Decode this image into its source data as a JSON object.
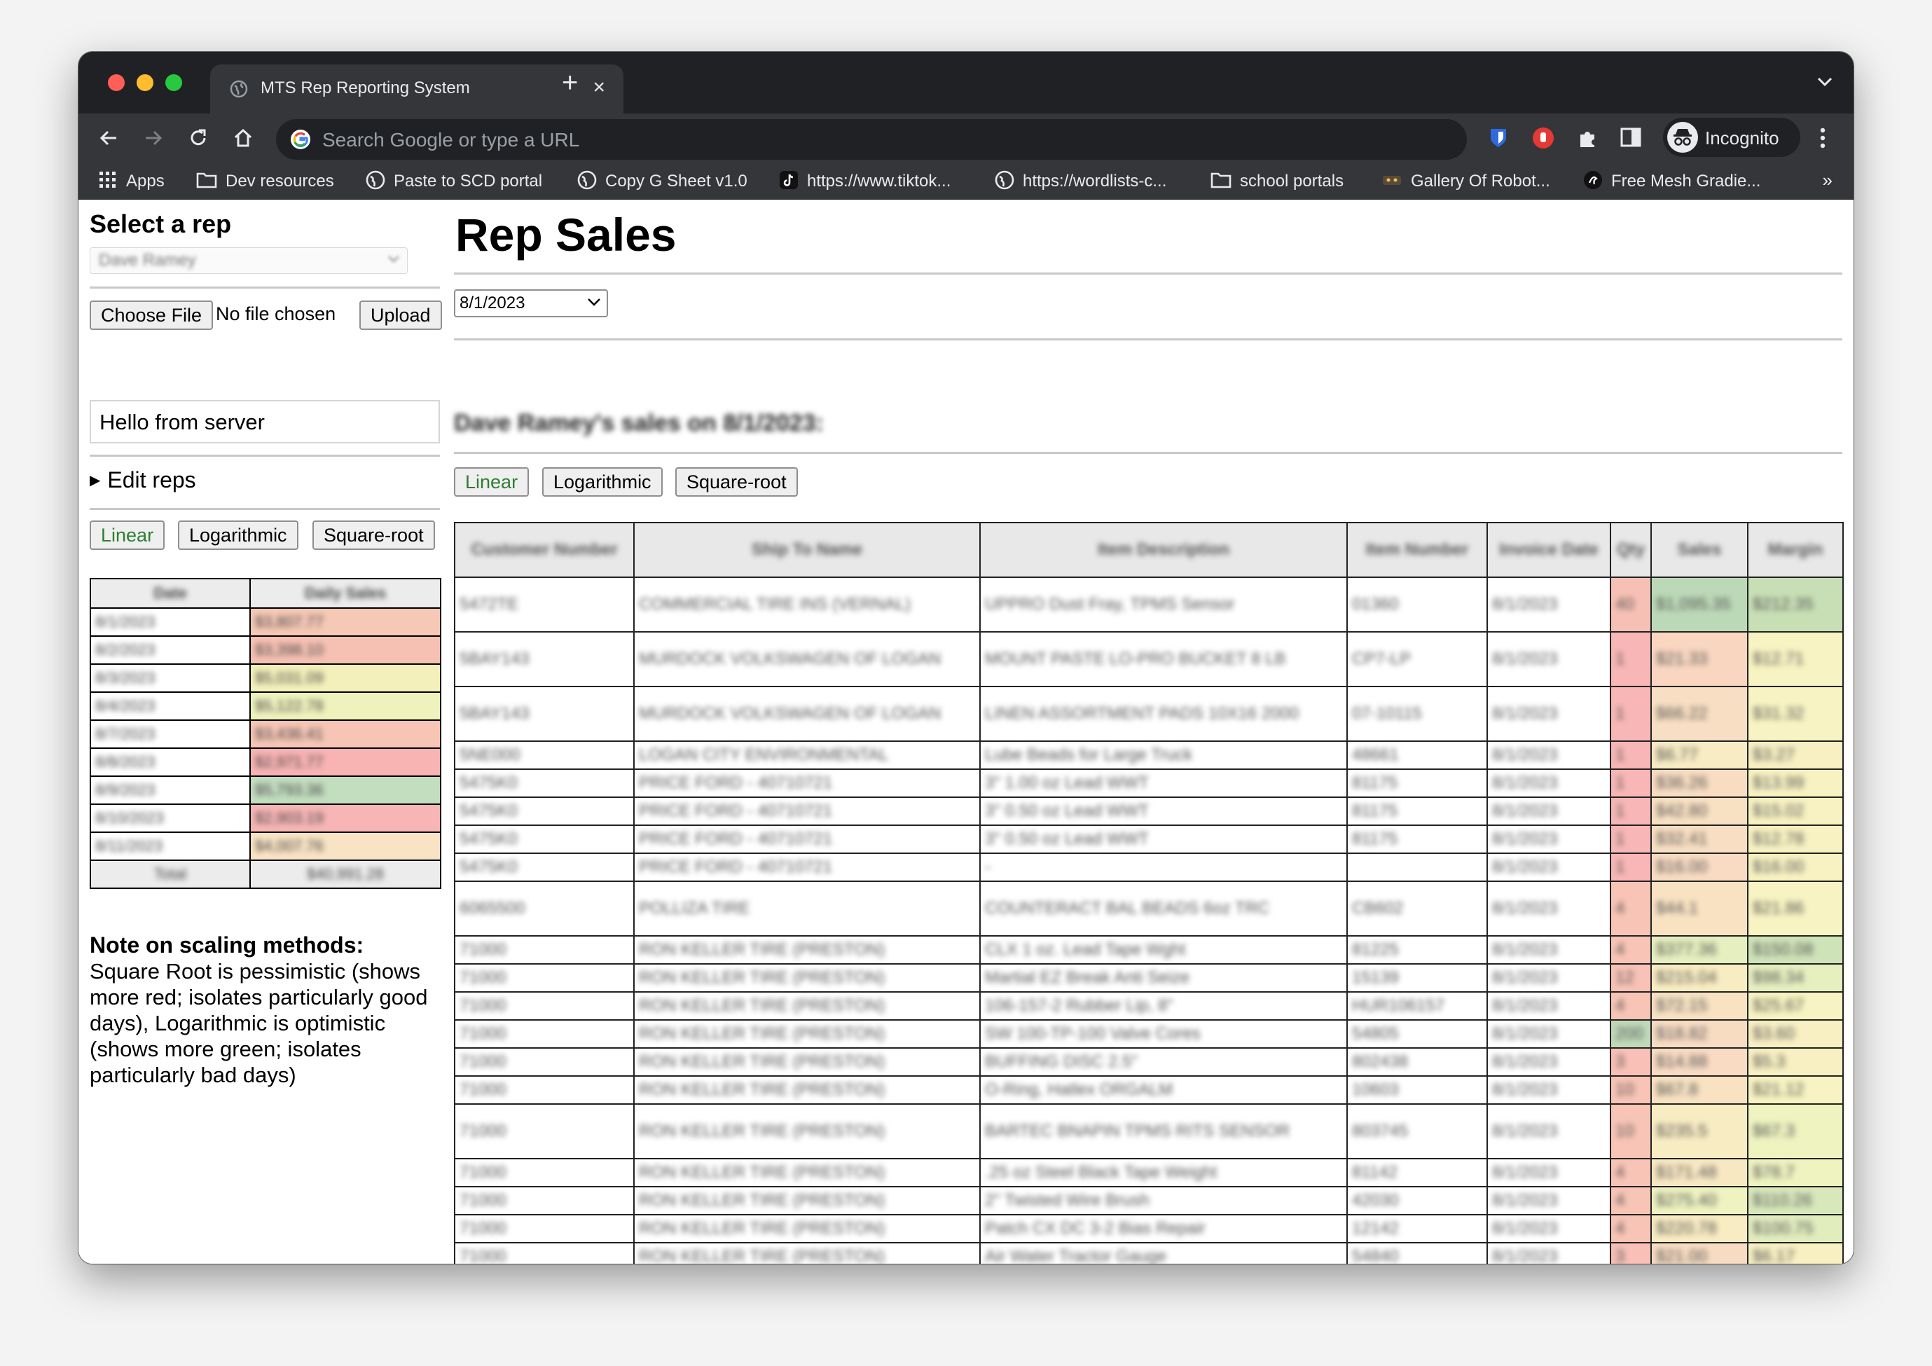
{
  "browser": {
    "tab_title": "MTS Rep Reporting System",
    "omnibox_placeholder": "Search Google or type a URL",
    "profile_label": "Incognito",
    "bookmarks": [
      {
        "label": "Apps",
        "icon": "apps-grid-icon"
      },
      {
        "label": "Dev resources",
        "icon": "folder-icon"
      },
      {
        "label": "Paste to SCD portal",
        "icon": "globe-icon"
      },
      {
        "label": "Copy G Sheet v1.0",
        "icon": "globe-icon"
      },
      {
        "label": "https://www.tiktok...",
        "icon": "tiktok-icon"
      },
      {
        "label": "https://wordlists-c...",
        "icon": "globe-icon"
      },
      {
        "label": "school portals",
        "icon": "folder-icon"
      },
      {
        "label": "Gallery Of Robot...",
        "icon": "robot-icon"
      },
      {
        "label": "Free Mesh Gradie...",
        "icon": "mesh-icon"
      }
    ],
    "more_bookmarks": "»"
  },
  "sidebar": {
    "select_rep_heading": "Select a rep",
    "selected_rep": "Dave Ramey",
    "choose_file_label": "Choose File",
    "no_file_label": "No file chosen",
    "upload_label": "Upload",
    "server_message": "Hello from server",
    "edit_reps_label": "Edit reps",
    "scale_buttons": [
      "Linear",
      "Logarithmic",
      "Square-root"
    ],
    "daily_table": {
      "headers": [
        "Date",
        "Daily Sales"
      ],
      "rows": [
        {
          "date": "8/1/2023",
          "sales": "$3,807.77",
          "color": "#f6c8b6"
        },
        {
          "date": "8/2/2023",
          "sales": "$3,398.10",
          "color": "#f6c1b3"
        },
        {
          "date": "8/3/2023",
          "sales": "$5,031.09",
          "color": "#f4f0bb"
        },
        {
          "date": "8/4/2023",
          "sales": "$5,122.78",
          "color": "#eef3bd"
        },
        {
          "date": "8/7/2023",
          "sales": "$3,436.41",
          "color": "#f6c5b5"
        },
        {
          "date": "8/8/2023",
          "sales": "$2,971.77",
          "color": "#f8b3b3"
        },
        {
          "date": "8/9/2023",
          "sales": "$5,793.36",
          "color": "#c3ddbf"
        },
        {
          "date": "8/10/2023",
          "sales": "$2,903.19",
          "color": "#f8b5b5"
        },
        {
          "date": "8/11/2023",
          "sales": "$4,007.76",
          "color": "#f8e3c4"
        }
      ],
      "total_label": "Total",
      "total_value": "$40,991.28"
    },
    "note_title": "Note on scaling methods:",
    "note_body": "Square Root is pessimistic (shows more red; isolates particularly good days), Logarithmic is optimistic (shows more green; isolates particularly bad days)"
  },
  "main": {
    "title": "Rep Sales",
    "date_value": "8/1/2023",
    "subheading": "Dave Ramey's sales on 8/1/2023:",
    "scale_buttons": [
      "Linear",
      "Logarithmic",
      "Square-root"
    ],
    "table_headers": [
      "Customer Number",
      "Ship To Name",
      "Item Description",
      "Item Number",
      "Invoice Date",
      "Qty",
      "Sales",
      "Margin"
    ],
    "rows": [
      {
        "cust": "5472TE",
        "ship": "COMMERCIAL TIRE INS (VERNAL)",
        "item": "UPPRO Dust Fray, TPMS Sensor",
        "num": "01360",
        "date": "8/1/2023",
        "qty": "40",
        "sales": "$1,095.35",
        "margin": "$212.35",
        "qty_color": "#f6c0b5",
        "sales_color": "#bcd9b7",
        "margin_color": "#c8dfb5",
        "tall": true
      },
      {
        "cust": "5BAY143",
        "ship": "MURDOCK VOLKSWAGEN OF LOGAN",
        "item": "MOUNT PASTE LO-PRO BUCKET 8 LB",
        "num": "CP7-LP",
        "date": "8/1/2023",
        "qty": "1",
        "sales": "$21.33",
        "margin": "$12.71",
        "qty_color": "#f8b6b6",
        "sales_color": "#f8d6c0",
        "margin_color": "#f8f3c2",
        "tall": true
      },
      {
        "cust": "5BAY143",
        "ship": "MURDOCK VOLKSWAGEN OF LOGAN",
        "item": "LINEN ASSORTMENT PADS 10X16 2000",
        "num": "07-10115",
        "date": "8/1/2023",
        "qty": "1",
        "sales": "$66.22",
        "margin": "$31.32",
        "qty_color": "#f8b6b6",
        "sales_color": "#f8dec2",
        "margin_color": "#f8f3c2",
        "tall": true
      },
      {
        "cust": "5NE000",
        "ship": "LOGAN CITY ENVIRONMENTAL",
        "item": "Lube Beads for Large Truck",
        "num": "48661",
        "date": "8/1/2023",
        "qty": "1",
        "sales": "$6.77",
        "margin": "$3.27",
        "qty_color": "#f8b6b6",
        "sales_color": "#f8ecc4",
        "margin_color": "#f8efc2",
        "tall": false
      },
      {
        "cust": "5475K0",
        "ship": "PRICE FORD - 40710721",
        "item": "3\" 1.00 oz Lead WWT",
        "num": "81175",
        "date": "8/1/2023",
        "qty": "1",
        "sales": "$36.26",
        "margin": "$13.99",
        "qty_color": "#f8b6b6",
        "sales_color": "#f8ddc2",
        "margin_color": "#f8f2c2",
        "tall": false
      },
      {
        "cust": "5475K0",
        "ship": "PRICE FORD - 40710721",
        "item": "3\" 0.50 oz Lead WWT",
        "num": "81175",
        "date": "8/1/2023",
        "qty": "1",
        "sales": "$42.80",
        "margin": "$15.02",
        "qty_color": "#f8b6b6",
        "sales_color": "#f8e0c2",
        "margin_color": "#f8f2c2",
        "tall": false
      },
      {
        "cust": "5475K0",
        "ship": "PRICE FORD - 40710721",
        "item": "3\" 0.50 oz Lead WWT",
        "num": "81175",
        "date": "8/1/2023",
        "qty": "1",
        "sales": "$32.41",
        "margin": "$12.78",
        "qty_color": "#f8b6b6",
        "sales_color": "#f8dec2",
        "margin_color": "#f8f2c2",
        "tall": false
      },
      {
        "cust": "5475K0",
        "ship": "PRICE FORD - 40710721",
        "item": "-",
        "num": "",
        "date": "8/1/2023",
        "qty": "1",
        "sales": "$16.00",
        "margin": "$16.00",
        "qty_color": "#f8b6b6",
        "sales_color": "#f8dbc2",
        "margin_color": "#f8f2c2",
        "tall": false
      },
      {
        "cust": "6065500",
        "ship": "POLLIZA TIRE",
        "item": "COUNTERACT BAL BEADS 6oz TRC",
        "num": "CB602",
        "date": "8/1/2023",
        "qty": "4",
        "sales": "$44.1",
        "margin": "$21.86",
        "qty_color": "#f8c4b6",
        "sales_color": "#f8e2c2",
        "margin_color": "#f8f3c2",
        "tall": true
      },
      {
        "cust": "71000",
        "ship": "RON KELLER TIRE (PRESTON)",
        "item": "CLX 1 oz. Lead Tape Wght",
        "num": "81225",
        "date": "8/1/2023",
        "qty": "4",
        "sales": "$377.36",
        "margin": "$150.08",
        "qty_color": "#f8c4b6",
        "sales_color": "#e6efbf",
        "margin_color": "#cfe3b8",
        "tall": false
      },
      {
        "cust": "71000",
        "ship": "RON KELLER TIRE (PRESTON)",
        "item": "Martial EZ Break Anti Seize",
        "num": "15139",
        "date": "8/1/2023",
        "qty": "12",
        "sales": "$215.04",
        "margin": "$98.34",
        "qty_color": "#f8c2b6",
        "sales_color": "#f8ecc2",
        "margin_color": "#e6efbf",
        "tall": false
      },
      {
        "cust": "71000",
        "ship": "RON KELLER TIRE (PRESTON)",
        "item": "106-157-2 Rubber Lip, 8\"",
        "num": "HUR106157",
        "date": "8/1/2023",
        "qty": "4",
        "sales": "$72.15",
        "margin": "$25.67",
        "qty_color": "#f8c4b6",
        "sales_color": "#f8e2c2",
        "margin_color": "#f8f3c2",
        "tall": false
      },
      {
        "cust": "71000",
        "ship": "RON KELLER TIRE (PRESTON)",
        "item": "SW 100-TP-100 Valve Cores",
        "num": "54805",
        "date": "8/1/2023",
        "qty": "200",
        "sales": "$18.82",
        "margin": "$3.60",
        "qty_color": "#c0dab9",
        "sales_color": "#f8dcc2",
        "margin_color": "#f8efc2",
        "tall": false
      },
      {
        "cust": "71000",
        "ship": "RON KELLER TIRE (PRESTON)",
        "item": "BUFFING DISC 2.5\"",
        "num": "802438",
        "date": "8/1/2023",
        "qty": "3",
        "sales": "$14.88",
        "margin": "$5.3",
        "qty_color": "#f8c0b6",
        "sales_color": "#f8dbc2",
        "margin_color": "#f8f0c2",
        "tall": false
      },
      {
        "cust": "71000",
        "ship": "RON KELLER TIRE (PRESTON)",
        "item": "O-Ring, Hatlex ORGALM",
        "num": "10603",
        "date": "8/1/2023",
        "qty": "10",
        "sales": "$67.8",
        "margin": "$21.12",
        "qty_color": "#f8c4b6",
        "sales_color": "#f8e2c2",
        "margin_color": "#f8f3c2",
        "tall": false
      },
      {
        "cust": "71000",
        "ship": "RON KELLER TIRE (PRESTON)",
        "item": "BARTEC BNAPIN TPMS RITS SENSOR",
        "num": "803745",
        "date": "8/1/2023",
        "qty": "10",
        "sales": "$235.5",
        "margin": "$67.3",
        "qty_color": "#f8c4b6",
        "sales_color": "#f8ecc2",
        "margin_color": "#eef3c0",
        "tall": true
      },
      {
        "cust": "71000",
        "ship": "RON KELLER TIRE (PRESTON)",
        "item": ".25 oz Steel Black Tape Weight",
        "num": "81142",
        "date": "8/1/2023",
        "qty": "4",
        "sales": "$171.48",
        "margin": "$78.7",
        "qty_color": "#f8c4b6",
        "sales_color": "#f8e8c2",
        "margin_color": "#eef3c0",
        "tall": false
      },
      {
        "cust": "71000",
        "ship": "RON KELLER TIRE (PRESTON)",
        "item": "2\" Twisted Wire Brush",
        "num": "42030",
        "date": "8/1/2023",
        "qty": "4",
        "sales": "$275.40",
        "margin": "$110.26",
        "qty_color": "#f8c4b6",
        "sales_color": "#eef3c0",
        "margin_color": "#d8e8bb",
        "tall": false
      },
      {
        "cust": "71000",
        "ship": "RON KELLER TIRE (PRESTON)",
        "item": "Patch CX DC 3-2 Bias Repair",
        "num": "12142",
        "date": "8/1/2023",
        "qty": "4",
        "sales": "$220.78",
        "margin": "$100.75",
        "qty_color": "#f8c4b6",
        "sales_color": "#f8ecc2",
        "margin_color": "#e2edbe",
        "tall": false
      },
      {
        "cust": "71000",
        "ship": "RON KELLER TIRE (PRESTON)",
        "item": "Air Water Tractor Gauge",
        "num": "54840",
        "date": "8/1/2023",
        "qty": "3",
        "sales": "$21.00",
        "margin": "$6.17",
        "qty_color": "#f8c0b6",
        "sales_color": "#f8dcc2",
        "margin_color": "#f8f0c2",
        "tall": false
      }
    ]
  },
  "colors": {
    "active_scale_text": "#2e7d32",
    "chrome_dark": "#202124",
    "chrome_toolbar": "#35363a",
    "traffic_red": "#ff5f57",
    "traffic_yellow": "#febc2e",
    "traffic_green": "#28c840"
  }
}
